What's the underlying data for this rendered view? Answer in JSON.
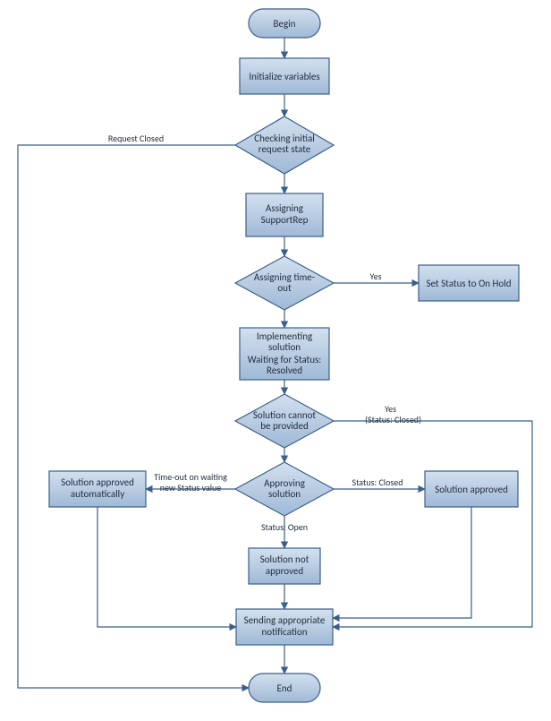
{
  "nodes": {
    "begin": "Begin",
    "init": "Initialize variables",
    "check": {
      "l1": "Checking initial",
      "l2": "request state"
    },
    "assignRep": {
      "l1": "Assigning",
      "l2": "SupportRep"
    },
    "assignTimeout": {
      "l1": "Assigning time-",
      "l2": "out"
    },
    "setOnHold": "Set Status to On Hold",
    "impl": {
      "l1": "Implementing",
      "l2": "solution",
      "l3": "Waiting for Status:",
      "l4": "Resolved"
    },
    "cannotProvide": {
      "l1": "Solution cannot",
      "l2": "be provided"
    },
    "approving": {
      "l1": "Approving",
      "l2": "solution"
    },
    "autoApprove": {
      "l1": "Solution approved",
      "l2": "automatically"
    },
    "approved": "Solution approved",
    "notApproved": {
      "l1": "Solution not",
      "l2": "approved"
    },
    "notify": {
      "l1": "Sending appropriate",
      "l2": "notification"
    },
    "end": "End"
  },
  "edges": {
    "requestClosed": "Request Closed",
    "yes1": "Yes",
    "yes2a": "Yes",
    "yes2b": "(Status: Closed)",
    "timeoutWaiting1": "Time-out on waiting",
    "timeoutWaiting2": "new Status value",
    "statusClosed": "Status: Closed",
    "statusOpen": "Status: Open"
  }
}
